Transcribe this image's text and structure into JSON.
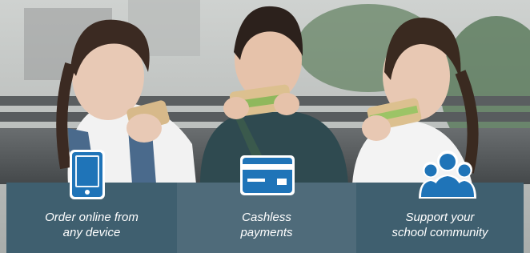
{
  "features": [
    {
      "label": "Order online from\nany device",
      "icon": "tablet-icon"
    },
    {
      "label": "Cashless\npayments",
      "icon": "credit-card-icon"
    },
    {
      "label": "Support your\nschool community",
      "icon": "people-group-icon"
    }
  ],
  "colors": {
    "panel_dark": "#3f5f6f",
    "panel_mid": "#4f6b7a",
    "icon_blue": "#1f74b8",
    "icon_bg": "#ffffff"
  }
}
